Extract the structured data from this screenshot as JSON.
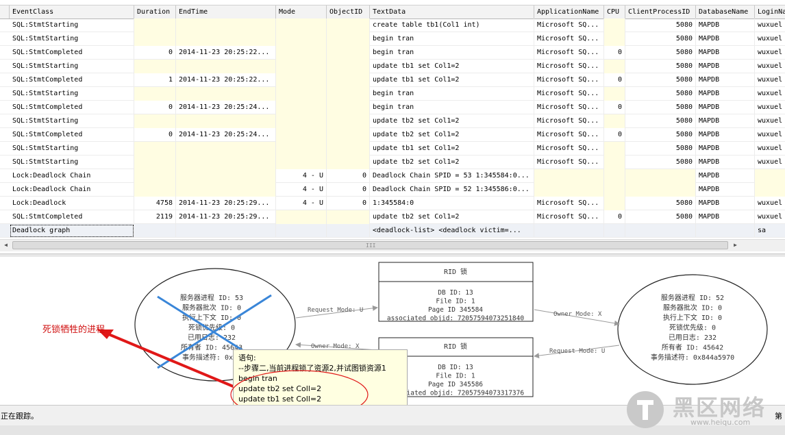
{
  "columns": [
    "EventClass",
    "Duration",
    "EndTime",
    "Mode",
    "ObjectID",
    "TextData",
    "ApplicationName",
    "CPU",
    "ClientProcessID",
    "DatabaseName",
    "LoginName"
  ],
  "rows": [
    {
      "event": "SQL:StmtStarting",
      "duration": "",
      "endtime": "",
      "mode": "",
      "objectid": "",
      "textdata": "create table tb1(Col1 int)",
      "app": "Microsoft SQ...",
      "cpu": "",
      "cpid": "5080",
      "db": "MAPDB",
      "login": "wuxuel"
    },
    {
      "event": "SQL:StmtStarting",
      "duration": "",
      "endtime": "",
      "mode": "",
      "objectid": "",
      "textdata": "begin tran",
      "app": "Microsoft SQ...",
      "cpu": "",
      "cpid": "5080",
      "db": "MAPDB",
      "login": "wuxuel"
    },
    {
      "event": "SQL:StmtCompleted",
      "duration": "0",
      "endtime": "2014-11-23 20:25:22...",
      "mode": "",
      "objectid": "",
      "textdata": "begin tran",
      "app": "Microsoft SQ...",
      "cpu": "0",
      "cpid": "5080",
      "db": "MAPDB",
      "login": "wuxuel"
    },
    {
      "event": "SQL:StmtStarting",
      "duration": "",
      "endtime": "",
      "mode": "",
      "objectid": "",
      "textdata": "update tb1 set Col1=2",
      "app": "Microsoft SQ...",
      "cpu": "",
      "cpid": "5080",
      "db": "MAPDB",
      "login": "wuxuel"
    },
    {
      "event": "SQL:StmtCompleted",
      "duration": "1",
      "endtime": "2014-11-23 20:25:22...",
      "mode": "",
      "objectid": "",
      "textdata": "update tb1 set Col1=2",
      "app": "Microsoft SQ...",
      "cpu": "0",
      "cpid": "5080",
      "db": "MAPDB",
      "login": "wuxuel"
    },
    {
      "event": "SQL:StmtStarting",
      "duration": "",
      "endtime": "",
      "mode": "",
      "objectid": "",
      "textdata": "begin tran",
      "app": "Microsoft SQ...",
      "cpu": "",
      "cpid": "5080",
      "db": "MAPDB",
      "login": "wuxuel"
    },
    {
      "event": "SQL:StmtCompleted",
      "duration": "0",
      "endtime": "2014-11-23 20:25:24...",
      "mode": "",
      "objectid": "",
      "textdata": "begin tran",
      "app": "Microsoft SQ...",
      "cpu": "0",
      "cpid": "5080",
      "db": "MAPDB",
      "login": "wuxuel"
    },
    {
      "event": "SQL:StmtStarting",
      "duration": "",
      "endtime": "",
      "mode": "",
      "objectid": "",
      "textdata": "update tb2 set Col1=2",
      "app": "Microsoft SQ...",
      "cpu": "",
      "cpid": "5080",
      "db": "MAPDB",
      "login": "wuxuel"
    },
    {
      "event": "SQL:StmtCompleted",
      "duration": "0",
      "endtime": "2014-11-23 20:25:24...",
      "mode": "",
      "objectid": "",
      "textdata": "update tb2 set Col1=2",
      "app": "Microsoft SQ...",
      "cpu": "0",
      "cpid": "5080",
      "db": "MAPDB",
      "login": "wuxuel"
    },
    {
      "event": "SQL:StmtStarting",
      "duration": "",
      "endtime": "",
      "mode": "",
      "objectid": "",
      "textdata": "update tb1 set Col1=2",
      "app": "Microsoft SQ...",
      "cpu": "",
      "cpid": "5080",
      "db": "MAPDB",
      "login": "wuxuel"
    },
    {
      "event": "SQL:StmtStarting",
      "duration": "",
      "endtime": "",
      "mode": "",
      "objectid": "",
      "textdata": "update tb2 set Col1=2",
      "app": "Microsoft SQ...",
      "cpu": "",
      "cpid": "5080",
      "db": "MAPDB",
      "login": "wuxuel"
    },
    {
      "event": "Lock:Deadlock Chain",
      "duration": "",
      "endtime": "",
      "mode": "4 - U",
      "objectid": "0",
      "textdata": "Deadlock Chain SPID = 53 1:345584:0...",
      "app": "",
      "cpu": "",
      "cpid": "",
      "db": "MAPDB",
      "login": ""
    },
    {
      "event": "Lock:Deadlock Chain",
      "duration": "",
      "endtime": "",
      "mode": "4 - U",
      "objectid": "0",
      "textdata": "Deadlock Chain SPID = 52 1:345586:0...",
      "app": "",
      "cpu": "",
      "cpid": "",
      "db": "MAPDB",
      "login": ""
    },
    {
      "event": "Lock:Deadlock",
      "duration": "4758",
      "endtime": "2014-11-23 20:25:29...",
      "mode": "4 - U",
      "objectid": "0",
      "textdata": "1:345584:0",
      "app": "Microsoft SQ...",
      "cpu": "",
      "cpid": "5080",
      "db": "MAPDB",
      "login": "wuxuel"
    },
    {
      "event": "SQL:StmtCompleted",
      "duration": "2119",
      "endtime": "2014-11-23 20:25:29...",
      "mode": "",
      "objectid": "",
      "textdata": "update tb2 set Col1=2",
      "app": "Microsoft SQ...",
      "cpu": "0",
      "cpid": "5080",
      "db": "MAPDB",
      "login": "wuxuel"
    },
    {
      "event": "Deadlock graph",
      "duration": "",
      "endtime": "",
      "mode": "",
      "objectid": "",
      "textdata": "<deadlock-list>   <deadlock victim=...",
      "app": "",
      "cpu": "",
      "cpid": "",
      "db": "",
      "login": "sa"
    }
  ],
  "graph": {
    "victim_process": [
      "服务器进程 ID: 53",
      "服务器批次 ID: 0",
      "执行上下文 ID: 0",
      "死锁优先级: 0",
      "已用日志: 232",
      "所有者 ID: 45643",
      "事务描述符: 0x8b"
    ],
    "other_process": [
      "服务器进程 ID: 52",
      "服务器批次 ID: 0",
      "执行上下文 ID: 0",
      "死锁优先级: 0",
      "已用日志: 232",
      "所有者 ID: 45642",
      "事务描述符: 0x844a5970"
    ],
    "rid1": {
      "title": "RID 锁",
      "lines": [
        "DB ID: 13",
        "File ID: 1",
        "Page ID 345584",
        "associated objid: 72057594073251840"
      ]
    },
    "rid2": {
      "title": "RID 锁",
      "lines": [
        "DB ID: 13",
        "File ID: 1",
        "Page ID 345586",
        "associated objid: 72057594073317376"
      ]
    },
    "edges": {
      "req1": "Request Mode: U",
      "own1": "Owner Mode: X",
      "own2": "Owner Mode: X",
      "req2": "Request Mode: U"
    }
  },
  "tooltip": {
    "lines": [
      "语句:",
      "--步骤二,当前进程锁了资源2,并试图锁资源1",
      "begin tran",
      "update tb2 set Coll=2",
      "update tb1 set Coll=2"
    ]
  },
  "annotation": {
    "label": "死锁牺牲的进程"
  },
  "status": {
    "text": "正在跟踪。",
    "right": "第"
  },
  "watermark": {
    "big": "黑区网络",
    "small": "www.heiqu.com"
  },
  "scroll": {
    "thumb_glyph": "III"
  },
  "colors": {
    "annotation_red": "#d01010",
    "tooltip_bg": "#ffffe1",
    "cell_yellow": "#fffde2",
    "victim_cross": "#3a86d8"
  }
}
